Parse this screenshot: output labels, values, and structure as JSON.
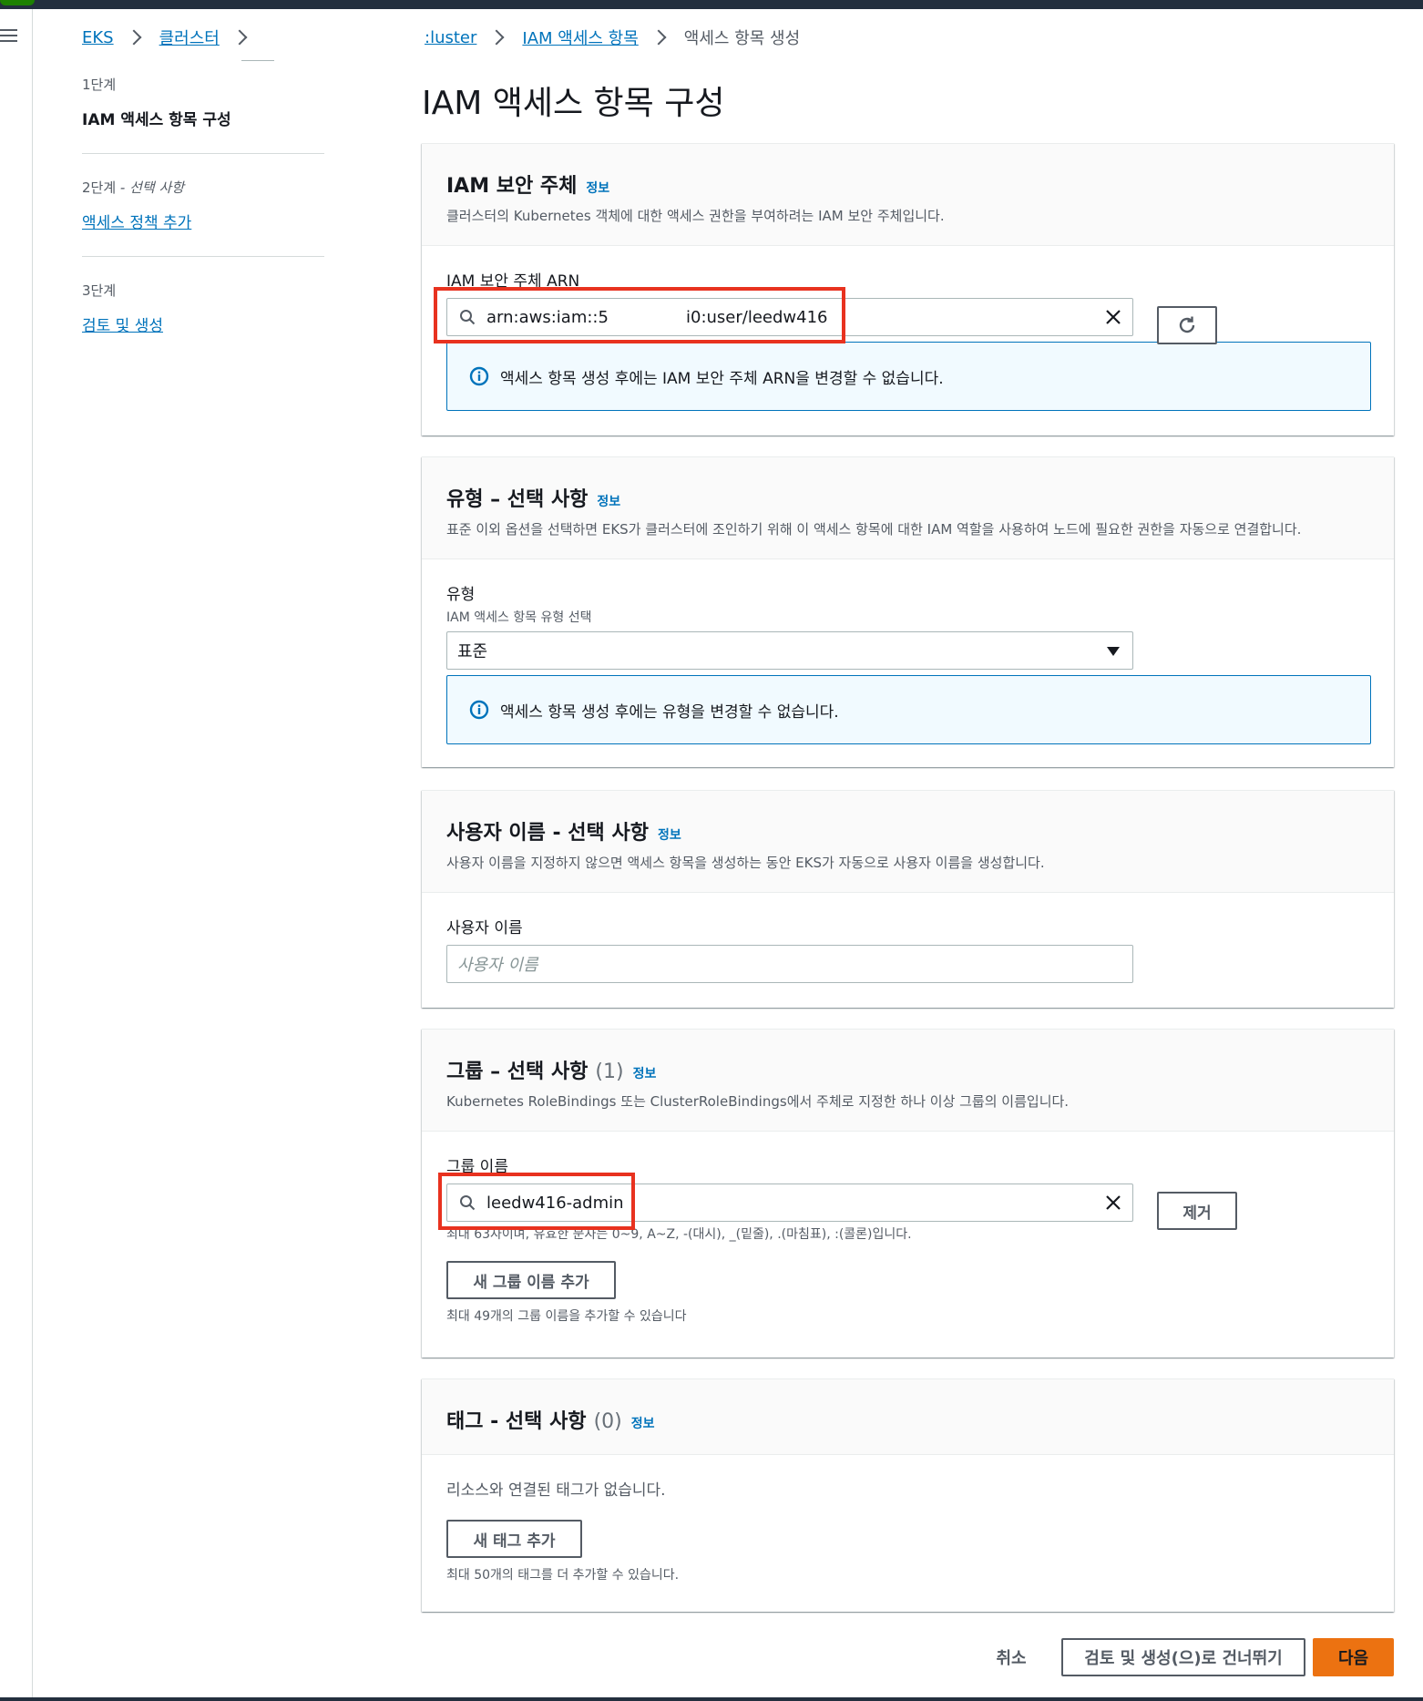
{
  "breadcrumb_left": [
    "EKS",
    "클러스터"
  ],
  "steps": [
    {
      "num": "1단계",
      "num_suffix": "",
      "title": "IAM 액세스 항목 구성",
      "active": true
    },
    {
      "num": "2단계",
      "num_suffix": " - 선택 사항",
      "title": "액세스 정책 추가",
      "active": false
    },
    {
      "num": "3단계",
      "num_suffix": "",
      "title": "검토 및 생성",
      "active": false
    }
  ],
  "breadcrumb_main": {
    "items": [
      ":luster",
      "IAM 액세스 항목"
    ],
    "current": "액세스 항목 생성"
  },
  "page_title": "IAM 액세스 항목 구성",
  "info_label": "정보",
  "principal": {
    "title": "IAM 보안 주체",
    "description": "클러스터의 Kubernetes 객체에 대한 액세스 권한을 부여하려는 IAM 보안 주체입니다.",
    "field_label": "IAM 보안 주체 ARN",
    "arn_prefix": "arn:aws:iam::5",
    "arn_suffix": "i0:user/leedw416",
    "alert": "액세스 항목 생성 후에는 IAM 보안 주체 ARN을 변경할 수 없습니다."
  },
  "type_section": {
    "title": "유형 – 선택 사항",
    "description": "표준 이외 옵션을 선택하면 EKS가 클러스터에 조인하기 위해 이 액세스 항목에 대한 IAM 역할을 사용하여 노드에 필요한 권한을 자동으로 연결합니다.",
    "field_label": "유형",
    "field_desc": "IAM 액세스 항목 유형 선택",
    "selected": "표준",
    "alert": "액세스 항목 생성 후에는 유형을 변경할 수 없습니다."
  },
  "username_section": {
    "title": "사용자 이름 - 선택 사항",
    "description": "사용자 이름을 지정하지 않으면 액세스 항목을 생성하는 동안 EKS가 자동으로 사용자 이름을 생성합니다.",
    "field_label": "사용자 이름",
    "placeholder": "사용자 이름"
  },
  "groups_section": {
    "title": "그룹 – 선택 사항",
    "count": "(1)",
    "description": "Kubernetes RoleBindings 또는 ClusterRoleBindings에서 주체로 지정한 하나 이상 그룹의 이름입니다.",
    "field_label": "그룹 이름",
    "group_value": "leedw416-admin",
    "constraint": "최대 63자이며, 유효한 문자는 0~9, A~Z, -(대시), _(밑줄), .(마침표), :(콜론)입니다.",
    "remove_button": "제거",
    "add_button": "새 그룹 이름 추가",
    "add_hint": "최대 49개의 그룹 이름을 추가할 수 있습니다"
  },
  "tags_section": {
    "title": "태그 - 선택 사항",
    "count": "(0)",
    "empty": "리소스와 연결된 태그가 없습니다.",
    "add_button": "새 태그 추가",
    "add_hint": "최대 50개의 태그를 더 추가할 수 있습니다."
  },
  "footer": {
    "cancel": "취소",
    "skip": "검토 및 생성(으)로 건너뛰기",
    "next": "다음"
  },
  "colors": {
    "link": "#0073bb",
    "primary": "#ec7211",
    "highlight": "#e8321f"
  },
  "icons": [
    "menu-icon",
    "chevron-right-icon",
    "search-icon",
    "close-icon",
    "refresh-icon",
    "info-icon",
    "caret-down-icon"
  ]
}
